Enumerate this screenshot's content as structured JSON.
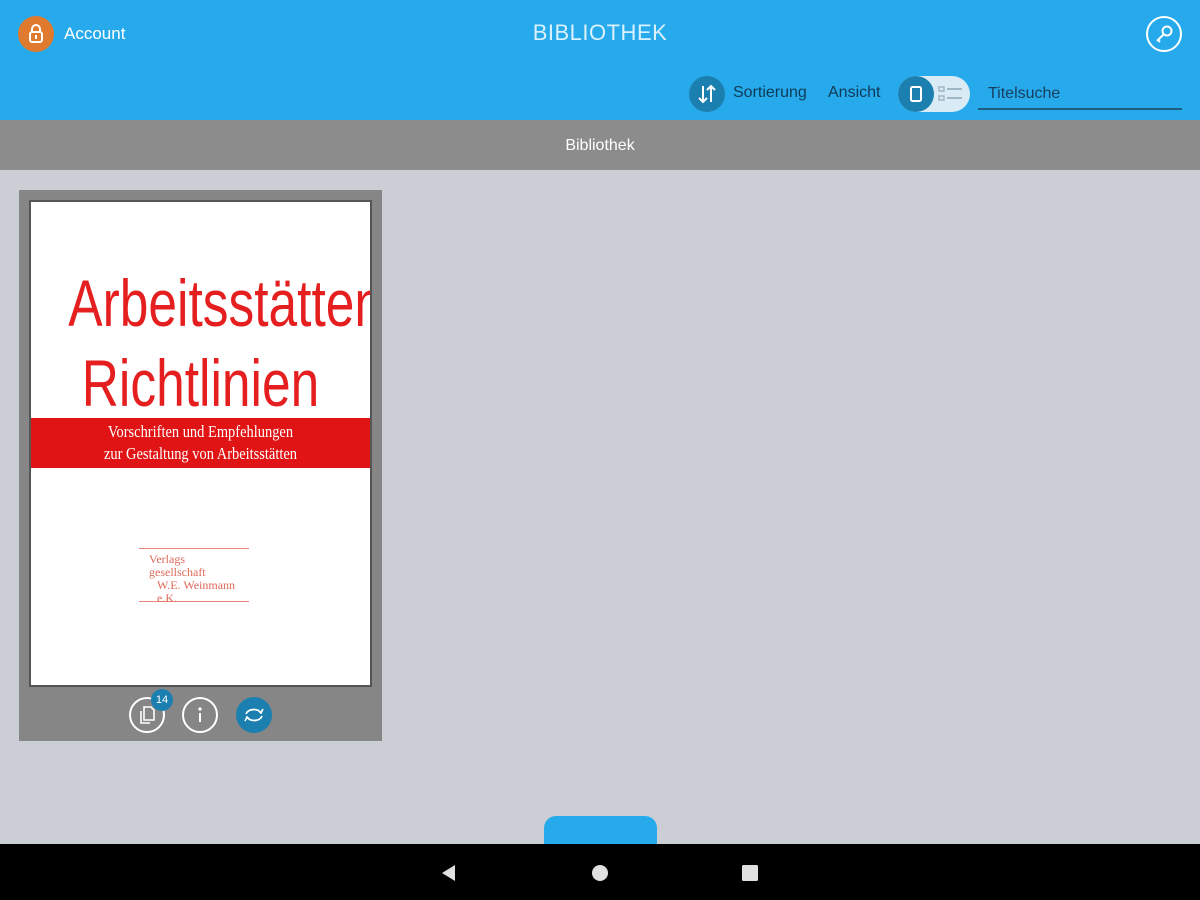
{
  "header": {
    "account_label": "Account",
    "title": "BIBLIOTHEK",
    "sort_label": "Sortierung",
    "view_label": "Ansicht",
    "search_placeholder": "Titelsuche"
  },
  "section": {
    "title": "Bibliothek"
  },
  "book": {
    "cover_title_line1": "Arbeitsstätten",
    "cover_title_line2": "Richtlinien",
    "cover_subtitle_line1": "Vorschriften und Empfehlungen",
    "cover_subtitle_line2": "zur Gestaltung von Arbeitsstätten",
    "publisher_line1": "Verlags",
    "publisher_line2": "gesellschaft",
    "publisher_line3": "W.E. Weinmann",
    "publisher_line4": "e.K.",
    "document_count": "14"
  },
  "colors": {
    "accent": "#27aaec",
    "accent_dark": "#1b7fb0",
    "avatar": "#e07a2e",
    "cover_red": "#e01414",
    "section_header": "#8c8c8c",
    "background": "#cbced5"
  },
  "icons": {
    "account": "lock-icon",
    "settings": "key-icon",
    "sort": "sort-arrows-icon",
    "view_grid": "single-view-icon",
    "view_list": "list-view-icon",
    "documents": "documents-icon",
    "info": "info-icon",
    "sync": "sync-icon",
    "nav_back": "back-icon",
    "nav_home": "home-icon",
    "nav_recents": "recents-icon"
  }
}
